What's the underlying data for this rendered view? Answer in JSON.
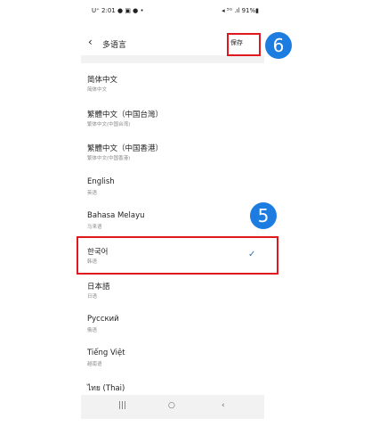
{
  "status": {
    "left": "U⁺ 2:01 ● ▣ ● •",
    "right": "◂ ⁵ᴳ .ıl 91%▮"
  },
  "appbar": {
    "back_icon": "chevron-left-icon",
    "title": "多语言",
    "save_label": "保存"
  },
  "languages": [
    {
      "name": "简体中文",
      "sub": "简体中文",
      "selected": false
    },
    {
      "name": "繁體中文（中国台灣）",
      "sub": "繁体中文(中国台湾)",
      "selected": false
    },
    {
      "name": "繁體中文（中国香港）",
      "sub": "繁体中文(中国香港)",
      "selected": false
    },
    {
      "name": "English",
      "sub": "英语",
      "selected": false
    },
    {
      "name": "Bahasa Melayu",
      "sub": "马来语",
      "selected": false
    },
    {
      "name": "한국어",
      "sub": "韩语",
      "selected": true
    },
    {
      "name": "日本語",
      "sub": "日语",
      "selected": false
    },
    {
      "name": "Русский",
      "sub": "俄语",
      "selected": false
    },
    {
      "name": "Tiếng Việt",
      "sub": "越南语",
      "selected": false
    },
    {
      "name": "ไทย (Thai)",
      "sub": "",
      "selected": false
    }
  ],
  "check_icon": "✓",
  "navbar": {
    "recents": "|||",
    "home": "○",
    "back": "‹"
  },
  "callouts": {
    "step5": "5",
    "step6": "6",
    "accent": "#e0181f",
    "badge": "#1c7ce0"
  }
}
